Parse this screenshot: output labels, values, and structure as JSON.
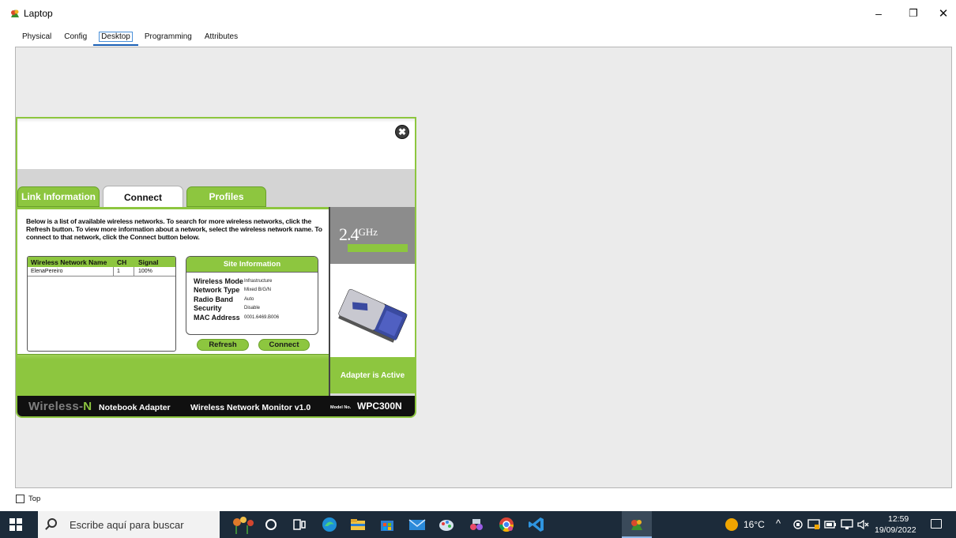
{
  "window": {
    "title": "Laptop",
    "controls": {
      "minimize": "–",
      "restore": "❐",
      "close": "✕"
    }
  },
  "tabs": [
    "Physical",
    "Config",
    "Desktop",
    "Programming",
    "Attributes"
  ],
  "active_tab": "Desktop",
  "monitor": {
    "close_symbol": "✖",
    "tabs": {
      "link_information": "Link Information",
      "connect": "Connect",
      "profiles": "Profiles"
    },
    "description_parts": {
      "p1": "Below is a list of available wireless networks. To search for more wireless networks, click the ",
      "refresh": "Refresh",
      "p2": " button. To view more information about a network, select the wireless network name. To connect to that network, click the ",
      "connect": "Connect",
      "p3": " button below."
    },
    "network_list": {
      "headers": {
        "name": "Wireless Network Name",
        "ch": "CH",
        "signal": "Signal"
      },
      "rows": [
        {
          "name": "ElenaPereiro",
          "ch": "1",
          "signal": "100%"
        }
      ]
    },
    "site_information": {
      "title": "Site Information",
      "rows": [
        {
          "label": "Wireless Mode",
          "value": "Infrastructure"
        },
        {
          "label": "Network Type",
          "value": "Mixed B/G/N"
        },
        {
          "label": "Radio Band",
          "value": "Auto"
        },
        {
          "label": "Security",
          "value": "Disable"
        },
        {
          "label": "MAC Address",
          "value": "0001.6469.B006"
        }
      ]
    },
    "buttons": {
      "refresh": "Refresh",
      "connect": "Connect"
    },
    "band": {
      "number": "2.4",
      "unit": "GHz"
    },
    "adapter_status": "Adapter is Active",
    "footer": {
      "brand_prefix": "Wireless-",
      "brand_letter": "N",
      "product": "Notebook Adapter",
      "monitor_name": "Wireless Network Monitor  v1.0",
      "model_label": "Model No.",
      "model_number": "WPC300N"
    }
  },
  "top_checkbox": {
    "label": "Top",
    "checked": false
  },
  "taskbar": {
    "search_placeholder": "Escribe aquí para buscar",
    "weather": "16°C",
    "time": "12:59",
    "date": "19/09/2022"
  },
  "colors": {
    "accent_green": "#8dc63f",
    "taskbar": "#1c2b3a",
    "desktop_bg": "#ebebeb"
  }
}
